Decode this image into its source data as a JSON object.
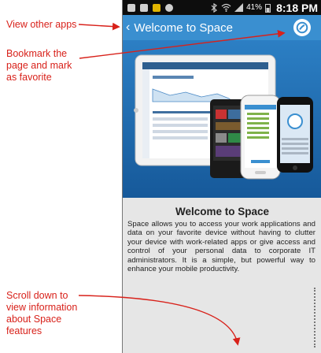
{
  "annotations": {
    "view_other_apps": "View other apps",
    "bookmark_line1": "Bookmark the",
    "bookmark_line2": "page and mark",
    "bookmark_line3": "as favorite",
    "scroll_line1": "Scroll down to",
    "scroll_line2": "view information",
    "scroll_line3": "about Space",
    "scroll_line4": "features"
  },
  "status_bar": {
    "battery": "41%",
    "time": "8:18 PM"
  },
  "app_bar": {
    "back_glyph": "‹",
    "title": "Welcome to Space"
  },
  "content": {
    "heading": "Welcome to Space",
    "body": "Space allows you to access your work applications and data on your favorite device without having to clutter your device with work-related apps or give access and control of your personal data to corporate IT administrators. It is a simple, but powerful way to enhance your mobile productivity."
  },
  "colors": {
    "annotation": "#d8211a",
    "app_bar": "#3a8fd0",
    "hero_bg": "#1f6fb4"
  }
}
